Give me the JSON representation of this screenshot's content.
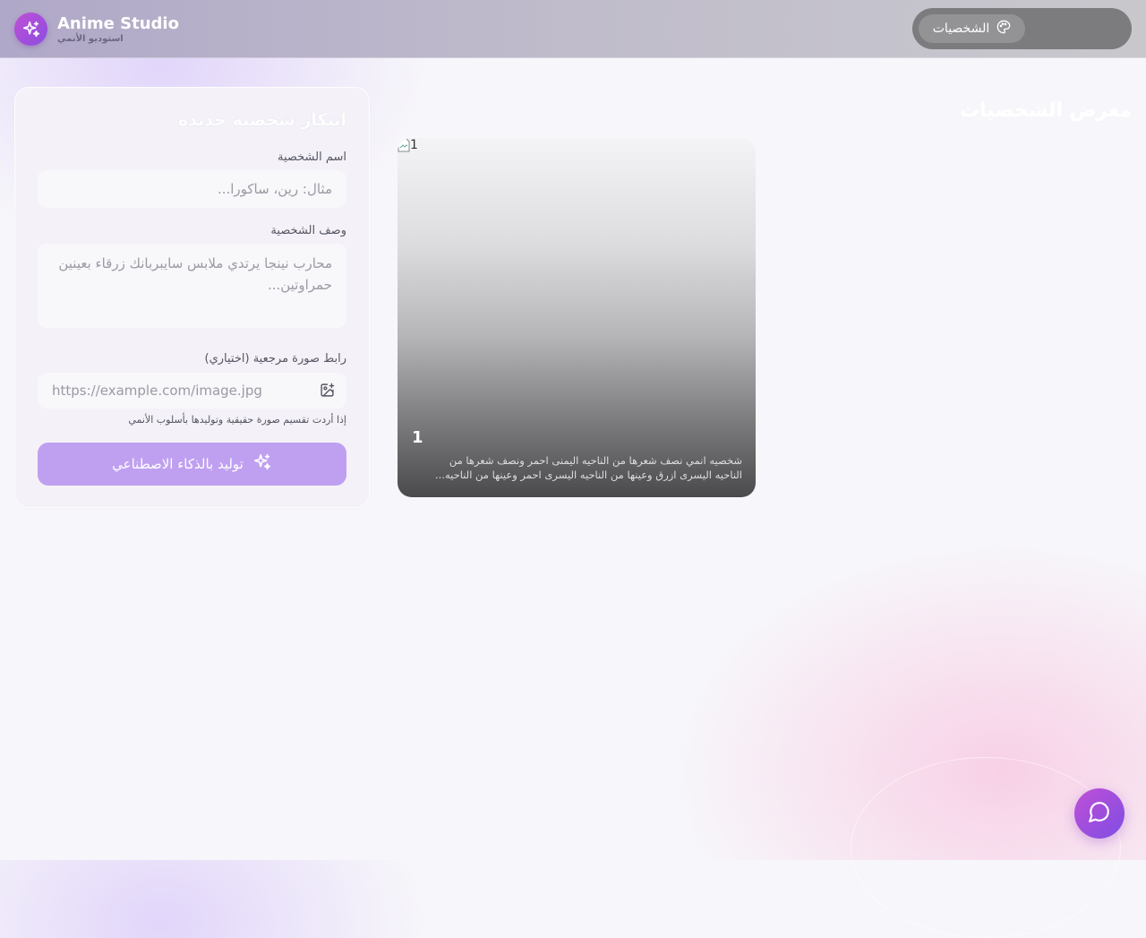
{
  "header": {
    "brand_title": "Anime Studio",
    "brand_subtitle": "استوديو الأنمي",
    "nav_tab_label": "الشخصيات",
    "logo_icon": "sparkles-icon",
    "nav_icon": "palette-icon"
  },
  "gallery": {
    "title": "معرض الشخصيات",
    "cards": [
      {
        "image_alt": "1",
        "name": "1",
        "description": "شخصيه انمي نصف شعرها من الناحيه اليمنى احمر ونصف شعرها من الناحيه اليسرى ازرق وعينها من الناحيه اليسرى احمر وعينها من الناحيه..."
      }
    ]
  },
  "form": {
    "title": "ابتكار شخصية جديدة",
    "name_label": "اسم الشخصية",
    "name_placeholder": "مثال: رين، ساكورا...",
    "desc_label": "وصف الشخصية",
    "desc_placeholder": "محارب نينجا يرتدي ملابس سايبربانك زرقاء بعينين حمراوتين...",
    "url_label": "رابط صورة مرجعية (اختياري)",
    "url_placeholder": "https://example.com/image.jpg",
    "url_icon": "image-plus-icon",
    "hint": "إذا أردت تقسيم صورة حقيقية وتوليدها بأسلوب الأنمي",
    "generate_label": "توليد بالذكاء الاصطناعي",
    "generate_icon": "sparkles-icon"
  },
  "chat": {
    "icon": "chat-bubble-icon"
  },
  "colors": {
    "accent": "#a855f7",
    "button": "#bfa0f0",
    "fab_start": "#c04fd6",
    "fab_end": "#7e4ee4"
  }
}
